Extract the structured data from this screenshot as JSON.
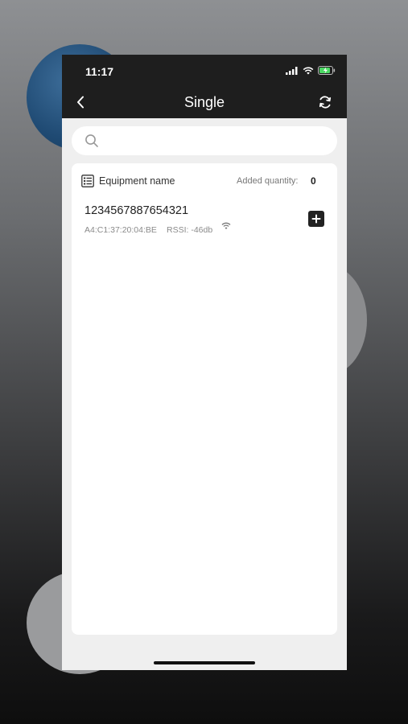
{
  "status_bar": {
    "time": "11:17"
  },
  "header": {
    "title": "Single",
    "back_icon": "chevron-left-icon",
    "refresh_icon": "refresh-icon"
  },
  "search": {
    "placeholder": "",
    "value": "",
    "icon": "search-icon"
  },
  "list": {
    "header_label": "Equipment name",
    "added_label": "Added quantity:",
    "added_count": "0",
    "items": [
      {
        "name": "1234567887654321",
        "mac": "A4:C1:37:20:04:BE",
        "rssi": "RSSI: -46db",
        "signal_icon": "wifi-signal-icon",
        "action_icon": "plus-icon"
      }
    ]
  },
  "colors": {
    "header_bg": "#1e1e1e",
    "page_bg": "#efefef",
    "card_bg": "#ffffff",
    "accent": "#222222"
  }
}
